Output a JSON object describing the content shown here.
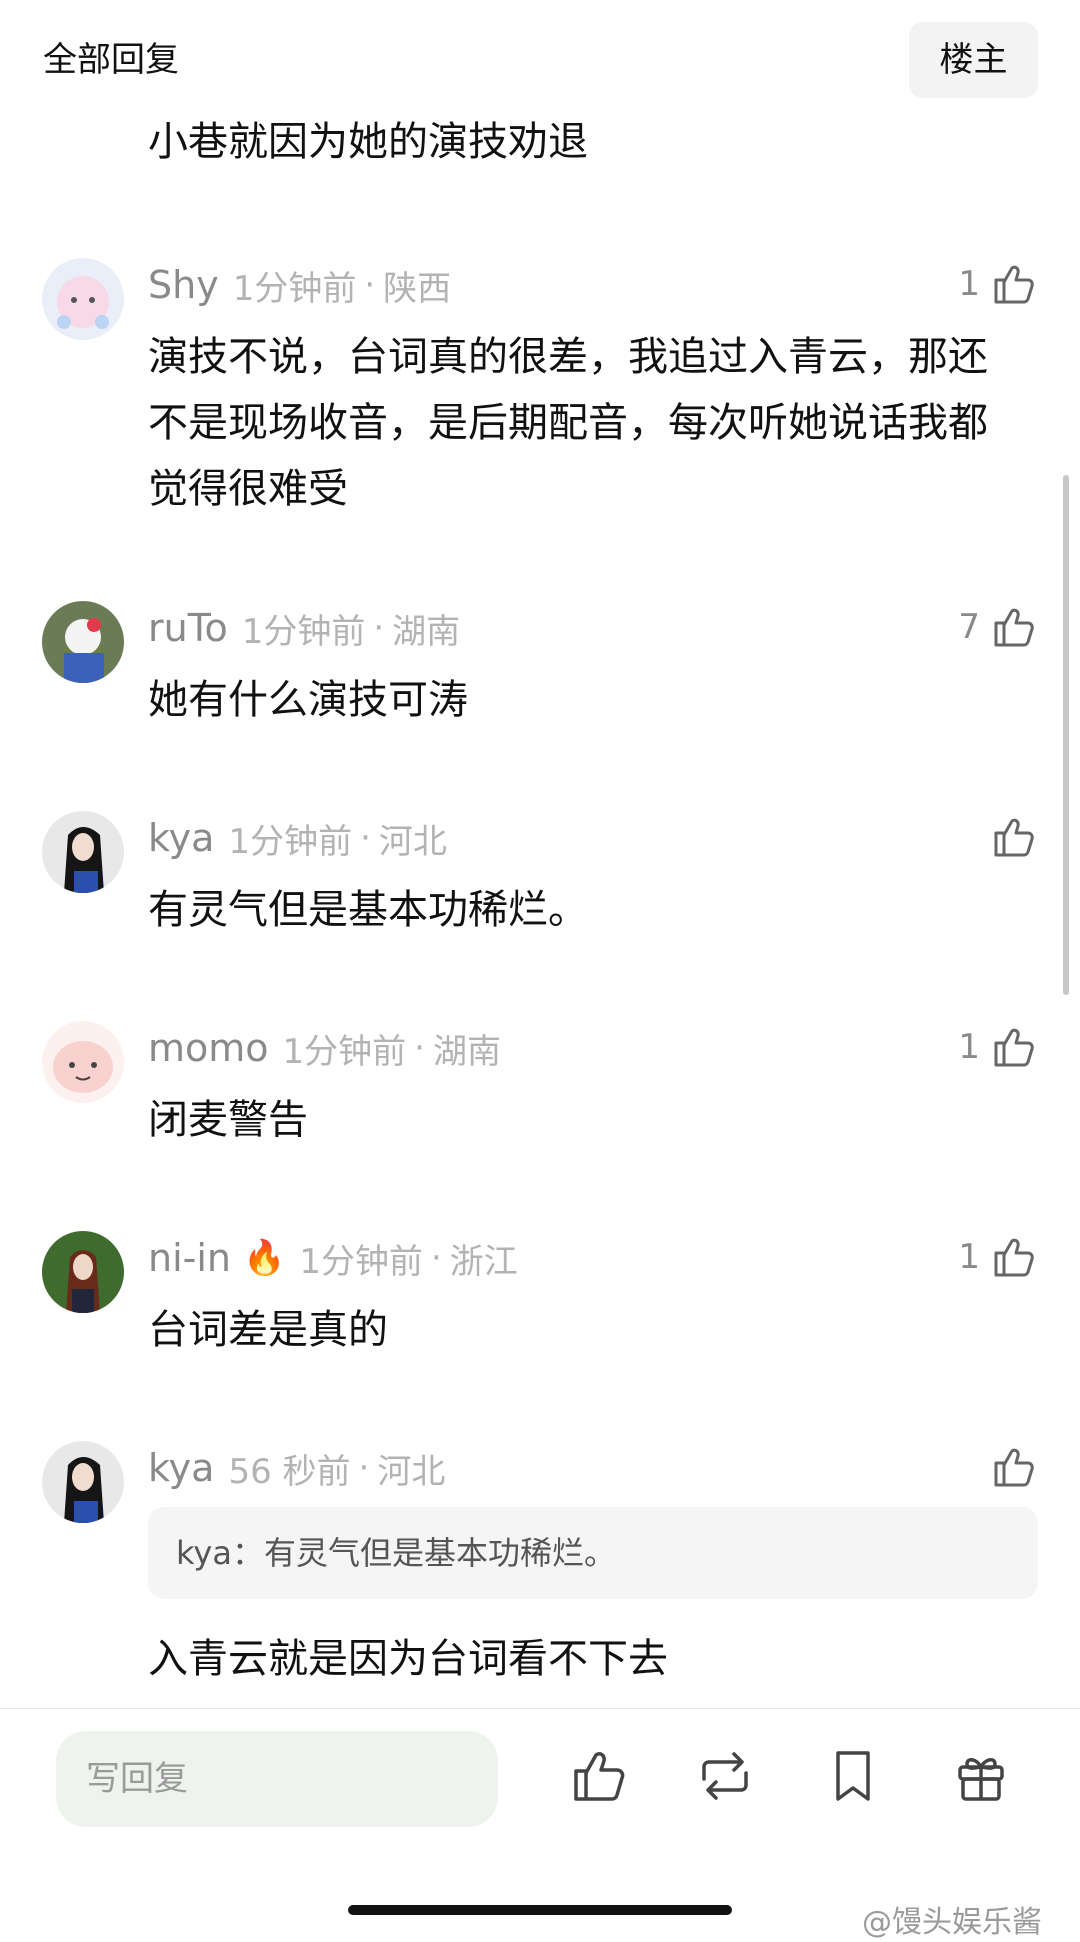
{
  "header": {
    "title": "全部回复",
    "op_button": "楼主"
  },
  "partial_comment": {
    "text": "小巷就因为她的演技劝退"
  },
  "comments": [
    {
      "user": "Shy",
      "time": "1分钟前",
      "location": "陕西",
      "likes": "1",
      "text": "演技不说，台词真的很差，我追过入青云，那还不是现场收音，是后期配音，每次听她说话我都觉得很难受"
    },
    {
      "user": "ruTo",
      "time": "1分钟前",
      "location": "湖南",
      "likes": "7",
      "text": "她有什么演技可涛"
    },
    {
      "user": "kya",
      "time": "1分钟前",
      "location": "河北",
      "likes": "",
      "text": "有灵气但是基本功稀烂。"
    },
    {
      "user": "momo",
      "time": "1分钟前",
      "location": "湖南",
      "likes": "1",
      "text": "闭麦警告"
    },
    {
      "user": "ni-in",
      "badge": "🔥",
      "time": "1分钟前",
      "location": "浙江",
      "likes": "1",
      "text": "台词差是真的"
    },
    {
      "user": "kya",
      "time": "56 秒前",
      "location": "河北",
      "likes": "",
      "quote": "kya：有灵气但是基本功稀烂。",
      "text": "入青云就是因为台词看不下去"
    }
  ],
  "bottom_bar": {
    "reply_placeholder": "写回复",
    "icons": [
      "like-icon",
      "repost-icon",
      "bookmark-icon",
      "gift-icon"
    ],
    "watermark": "@馒头娱乐酱"
  },
  "colors": {
    "meta": "#8a8a8a",
    "meta_light": "#b3b3b3",
    "input_bg": "#eef3ee",
    "quote_bg": "#f5f5f5"
  }
}
